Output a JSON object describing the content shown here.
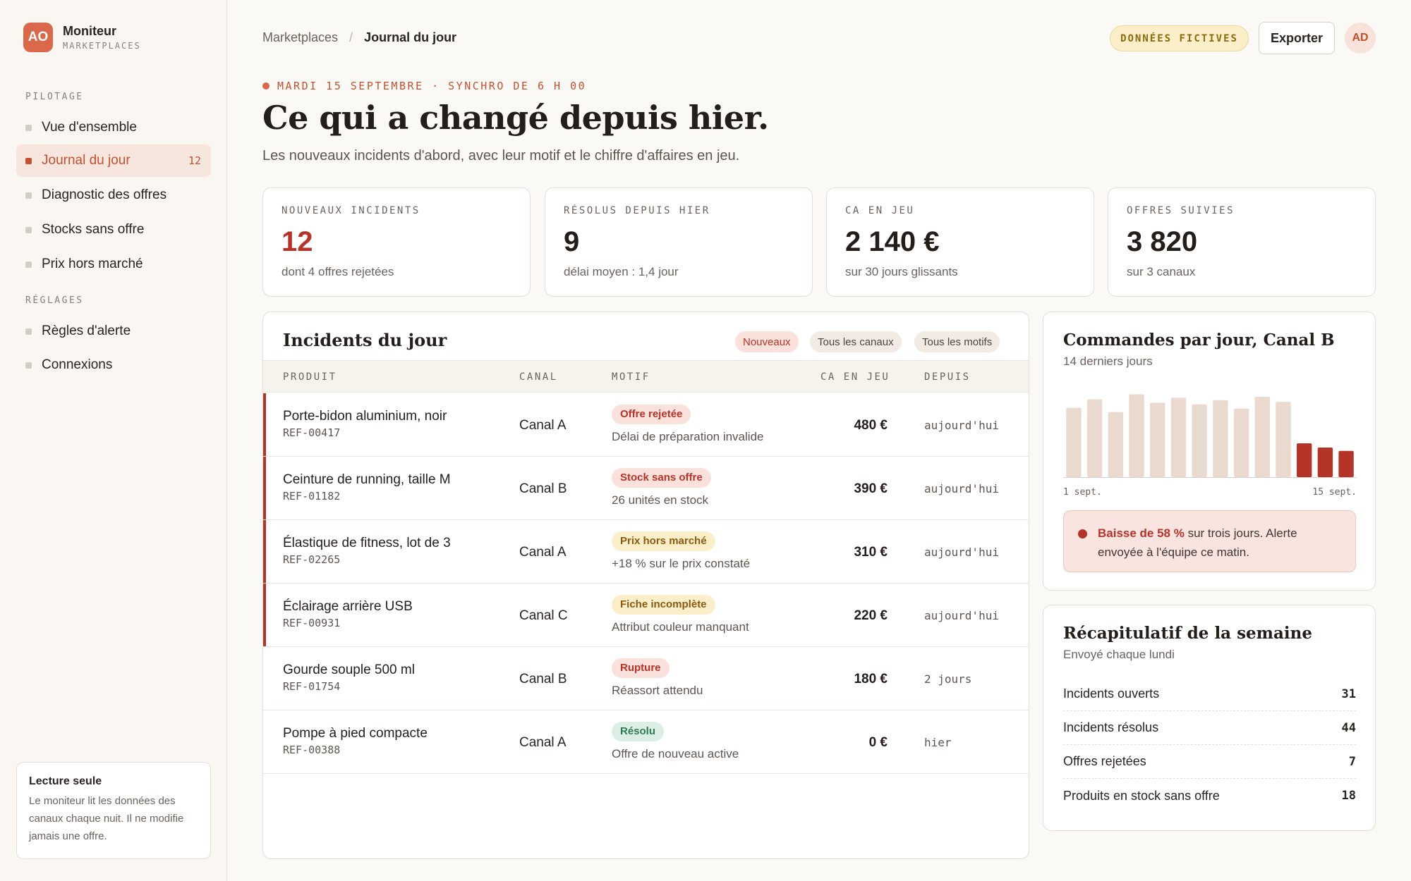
{
  "brand": {
    "logo": "AO",
    "name": "Moniteur",
    "subtitle": "MARKETPLACES"
  },
  "sidebar": {
    "section_pilotage": "PILOTAGE",
    "section_reglages": "RÉGLAGES",
    "items": [
      {
        "label": "Vue d'ensemble"
      },
      {
        "label": "Journal du jour",
        "count": "12",
        "active": true
      },
      {
        "label": "Diagnostic des offres"
      },
      {
        "label": "Stocks sans offre"
      },
      {
        "label": "Prix hors marché"
      },
      {
        "label": "Règles d'alerte"
      },
      {
        "label": "Connexions"
      }
    ],
    "readonly": {
      "title": "Lecture seule",
      "text": "Le moniteur lit les données des canaux chaque nuit. Il ne modifie jamais une offre."
    }
  },
  "header": {
    "breadcrumb": [
      "Marketplaces",
      "Journal du jour"
    ],
    "badge": "DONNÉES FICTIVES",
    "export_label": "Exporter",
    "avatar": "AD"
  },
  "intro": {
    "date_line": "MARDI 15 SEPTEMBRE · SYNCHRO DE 6 H 00",
    "title": "Ce qui a changé depuis hier.",
    "subtitle": "Les nouveaux incidents d'abord, avec leur motif et le chiffre d'affaires en jeu."
  },
  "kpis": [
    {
      "label": "NOUVEAUX INCIDENTS",
      "value": "12",
      "sub": "dont 4 offres rejetées"
    },
    {
      "label": "RÉSOLUS DEPUIS HIER",
      "value": "9",
      "sub": "délai moyen : 1,4 jour"
    },
    {
      "label": "CA EN JEU",
      "value": "2 140 €",
      "sub": "sur 30 jours glissants"
    },
    {
      "label": "OFFRES SUIVIES",
      "value": "3 820",
      "sub": "sur 3 canaux"
    }
  ],
  "incidents": {
    "title": "Incidents du jour",
    "filters": [
      "Nouveaux",
      "Tous les canaux",
      "Tous les motifs"
    ],
    "columns": [
      "PRODUIT",
      "CANAL",
      "MOTIF",
      "CA EN JEU",
      "DEPUIS"
    ],
    "rows": [
      {
        "name": "Porte-bidon aluminium, noir",
        "ref": "REF-00417",
        "canal": "Canal A",
        "motif": "Offre rejetée",
        "detail": "Délai de préparation invalide",
        "ca": "480 €",
        "since": "aujourd'hui"
      },
      {
        "name": "Ceinture de running, taille M",
        "ref": "REF-01182",
        "canal": "Canal B",
        "motif": "Stock sans offre",
        "detail": "26 unités en stock",
        "ca": "390 €",
        "since": "aujourd'hui"
      },
      {
        "name": "Élastique de fitness, lot de 3",
        "ref": "REF-02265",
        "canal": "Canal A",
        "motif": "Prix hors marché",
        "detail": "+18 % sur le prix constaté",
        "ca": "310 €",
        "since": "aujourd'hui"
      },
      {
        "name": "Éclairage arrière USB",
        "ref": "REF-00931",
        "canal": "Canal C",
        "motif": "Fiche incomplète",
        "detail": "Attribut couleur manquant",
        "ca": "220 €",
        "since": "aujourd'hui"
      },
      {
        "name": "Gourde souple 500 ml",
        "ref": "REF-01754",
        "canal": "Canal B",
        "motif": "Rupture",
        "detail": "Réassort attendu",
        "ca": "180 €",
        "since": "2 jours"
      },
      {
        "name": "Pompe à pied compacte",
        "ref": "REF-00388",
        "canal": "Canal A",
        "motif": "Résolu",
        "detail": "Offre de nouveau active",
        "ca": "0 €",
        "since": "hier"
      }
    ]
  },
  "chart": {
    "title": "Commandes par jour, Canal B",
    "subtitle": "14 derniers jours",
    "alert_strong": "Baisse de 58 %",
    "alert_rest": " sur trois jours. Alerte envoyée à l'équipe ce matin."
  },
  "chart_data": {
    "type": "bar",
    "title": "Commandes par jour, Canal B",
    "categories": [
      "1 sept.",
      "2",
      "3",
      "4",
      "5",
      "6",
      "7",
      "8",
      "9",
      "10",
      "11",
      "12",
      "13",
      "15 sept."
    ],
    "tick_labels": [
      "1 sept.",
      "15 sept."
    ],
    "values": [
      82,
      92,
      77,
      98,
      88,
      94,
      86,
      91,
      81,
      95,
      89,
      40,
      35,
      31
    ],
    "highlight_last": 3,
    "colors": {
      "normal": "#ead9ce",
      "highlight": "#b5342a"
    },
    "ylim": [
      0,
      100
    ]
  },
  "recap": {
    "title": "Récapitulatif de la semaine",
    "subtitle": "Envoyé chaque lundi",
    "rows": [
      {
        "label": "Incidents ouverts",
        "value": "31"
      },
      {
        "label": "Incidents résolus",
        "value": "44"
      },
      {
        "label": "Offres rejetées",
        "value": "7"
      },
      {
        "label": "Produits en stock sans offre",
        "value": "18"
      }
    ]
  }
}
